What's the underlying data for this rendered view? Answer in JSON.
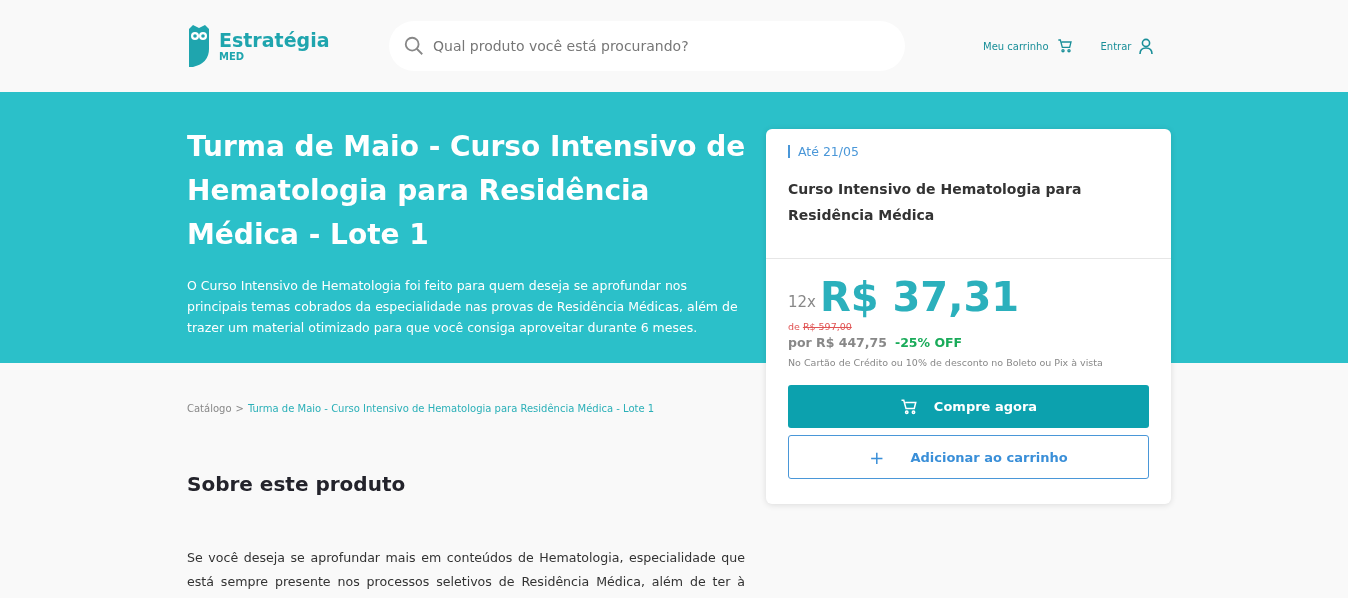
{
  "header": {
    "logo": {
      "name": "Estratégia",
      "sub": "MED"
    },
    "search": {
      "placeholder": "Qual produto você está procurando?"
    },
    "cart_link": "Meu carrinho",
    "login_link": "Entrar"
  },
  "hero": {
    "title": "Turma de Maio - Curso Intensivo de Hematologia para Residência Médica - Lote 1",
    "description": "O Curso Intensivo de Hematologia foi feito para quem deseja se aprofundar nos principais temas cobrados da especialidade nas provas de Residência Médicas, além de trazer um material otimizado para que você consiga aproveitar durante 6 meses."
  },
  "breadcrumb": [
    {
      "label": "Catálogo",
      "selected": false
    },
    {
      "label": "Turma de Maio - Curso Intensivo de Hematologia para Residência Médica - Lote 1",
      "selected": true
    }
  ],
  "breadcrumb_separator": ">",
  "about": {
    "heading": "Sobre este produto",
    "lines": [
      "Se você deseja se aprofundar mais em conteúdos de Hematologia, especialidade que",
      "está sempre presente nos processos seletivos de Residência Médica, além de ter à"
    ]
  },
  "offer_card": {
    "deadline": "Até 21/05",
    "product": "Curso Intensivo de Hematologia para Residência Médica",
    "installments": "12x",
    "installment_price": "R$ 37,31",
    "old_price_prefix": "de",
    "old_price": "R$ 597,00",
    "price": "por R$ 447,75",
    "discount": "-25% OFF",
    "payment_note": "No Cartão de Crédito ou 10% de desconto no Boleto ou Pix à vista",
    "buy_button": "Compre agora",
    "add_button": "Adicionar ao carrinho",
    "add_icon": "+"
  }
}
